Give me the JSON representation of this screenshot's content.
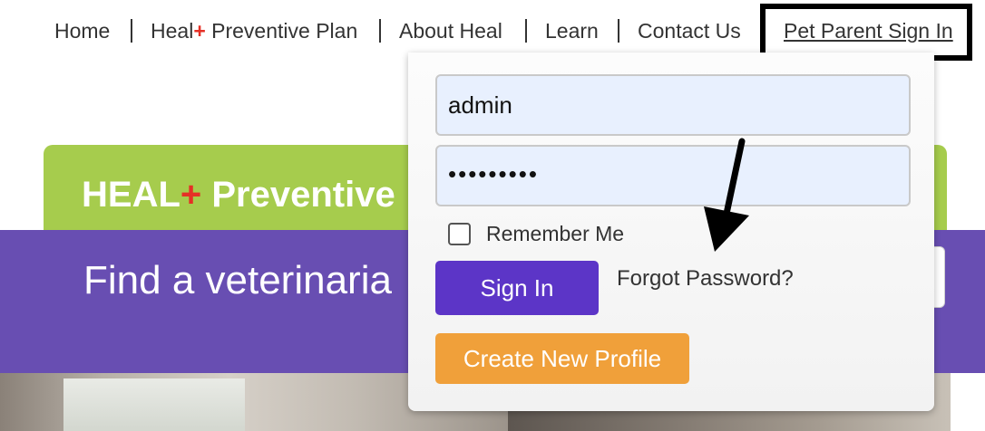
{
  "nav": {
    "home": "Home",
    "heal_prefix": "Heal",
    "heal_plus": "+",
    "heal_suffix": " Preventive Plan",
    "about": "About Heal",
    "learn": "Learn",
    "contact": "Contact Us",
    "signin": "Pet Parent Sign In"
  },
  "banner": {
    "title_prefix": "HEAL",
    "title_plus": "+",
    "title_suffix": " Preventive"
  },
  "purple": {
    "text": "Find a veterinaria"
  },
  "login": {
    "username_value": "admin",
    "password_mask": "•••••••••",
    "remember_label": "Remember Me",
    "signin_label": "Sign In",
    "forgot_label": "Forgot Password?",
    "create_label": "Create New Profile"
  },
  "colors": {
    "accent_purple": "#684eb2",
    "button_purple": "#5c35c7",
    "banner_green": "#a6cc4d",
    "create_orange": "#f0a03a",
    "plus_red": "#e53026"
  },
  "icons": {
    "annotation": "arrow-pointer-icon"
  }
}
